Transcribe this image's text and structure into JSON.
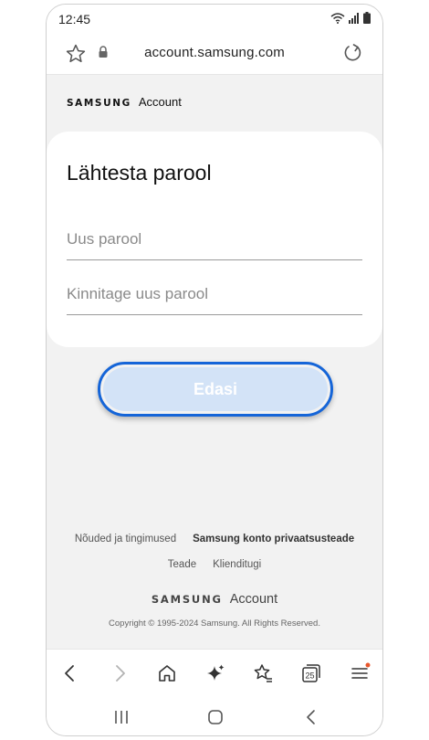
{
  "status_bar": {
    "time": "12:45"
  },
  "browser": {
    "url": "account.samsung.com"
  },
  "page": {
    "brand": {
      "samsung": "SAMSUNG",
      "account": "Account"
    },
    "title": "Lähtesta parool",
    "fields": {
      "new_password_placeholder": "Uus parool",
      "confirm_password_placeholder": "Kinnitage uus parool"
    },
    "next_button": "Edasi",
    "footer": {
      "terms": "Nõuded ja tingimused",
      "privacy": "Samsung konto privaatsusteade",
      "notice": "Teade",
      "support": "Klienditugi",
      "brand_samsung": "SAMSUNG",
      "brand_account": "Account",
      "copyright": "Copyright © 1995-2024 Samsung. All Rights Reserved."
    }
  },
  "toolbar": {
    "tabs_count": "25",
    "icons": [
      "back-icon",
      "forward-icon",
      "home-icon",
      "sparkle-icon",
      "bookmarks-icon",
      "tabs-icon",
      "menu-icon"
    ]
  },
  "colors": {
    "accent": "#1565d8",
    "button_fill": "#d3e3f7",
    "page_bg": "#f2f2f2",
    "notification_dot": "#e8572c"
  }
}
